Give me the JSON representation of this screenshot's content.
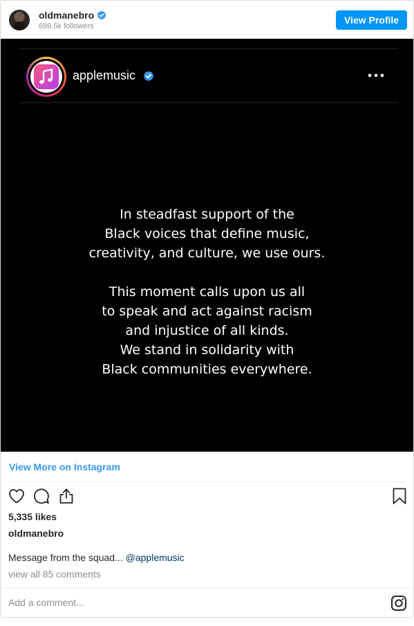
{
  "header": {
    "username": "oldmanebro",
    "followers": "699.5k followers",
    "view_profile_label": "View Profile"
  },
  "post_image": {
    "account_name": "applemusic",
    "message_paragraph_1": [
      "In steadfast support of the",
      "Black voices that define music,",
      "creativity, and culture, we use ours."
    ],
    "message_paragraph_2": [
      "This moment calls upon us all",
      "to speak and act against racism",
      "and injustice of all kinds.",
      "We stand in solidarity with",
      "Black communities everywhere."
    ]
  },
  "view_more_label": "View More on Instagram",
  "likes": "5,335 likes",
  "owner": "oldmanebro",
  "caption": {
    "text": "Message from the squad... ",
    "mention": "@applemusic"
  },
  "comments_link": "view all 85 comments",
  "comment_placeholder": "Add a comment...",
  "colors": {
    "accent_blue": "#0095f6",
    "link_blue": "#3897f0",
    "mention_blue": "#00376b",
    "muted": "#8e8e8e"
  },
  "icons": [
    "verified-badge-icon",
    "apple-music-logo-icon",
    "more-options-icon",
    "heart-icon",
    "comment-icon",
    "share-icon",
    "bookmark-icon",
    "instagram-logo-icon"
  ]
}
